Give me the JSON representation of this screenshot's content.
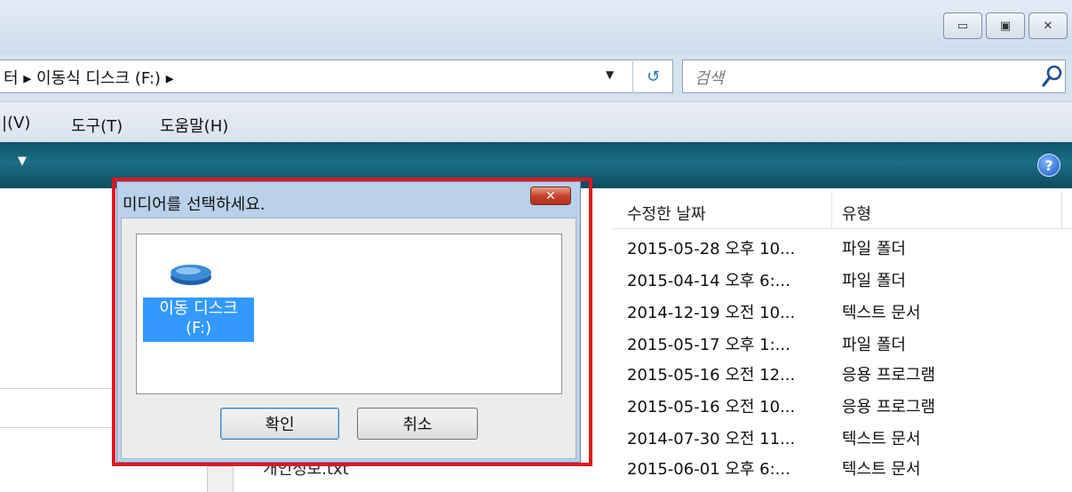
{
  "window": {
    "controls": {
      "minimize": "▭",
      "maximize": "▣",
      "close": "✕"
    }
  },
  "address": {
    "breadcrumb": "터 ▸ 이동식 디스크 (F:) ▸",
    "dropdown": "▼",
    "refresh": "↺",
    "search_placeholder": "검색"
  },
  "menu": {
    "items": [
      "|(V)",
      "도구(T)",
      "도움말(H)"
    ]
  },
  "columns": {
    "date": "수정한 날짜",
    "type": "유형"
  },
  "rows": [
    {
      "date": "2015-05-28 오후 10...",
      "type": "파일 폴더"
    },
    {
      "date": "2015-04-14 오후 6:...",
      "type": "파일 폴더"
    },
    {
      "date": "2014-12-19 오전 10...",
      "type": "텍스트 문서"
    },
    {
      "date": "2015-05-17 오후 1:...",
      "type": "파일 폴더"
    },
    {
      "date": "2015-05-16 오전 12...",
      "type": "응용 프로그램"
    },
    {
      "date": "2015-05-16 오전 10...",
      "type": "응용 프로그램"
    },
    {
      "date": "2014-07-30 오전 11...",
      "type": "텍스트 문서"
    },
    {
      "date": "2015-06-01 오후 6:...",
      "type": "텍스트 문서"
    }
  ],
  "partial_row_name": "개인정보.txt",
  "dialog": {
    "title": "미디어를 선택하세요.",
    "drive_name": "이동 디스크",
    "drive_letter": "(F:)",
    "ok": "확인",
    "cancel": "취소"
  },
  "colors": {
    "highlight": "#e0151f",
    "selection": "#3399ff",
    "command_bar": "#1b6e86"
  }
}
